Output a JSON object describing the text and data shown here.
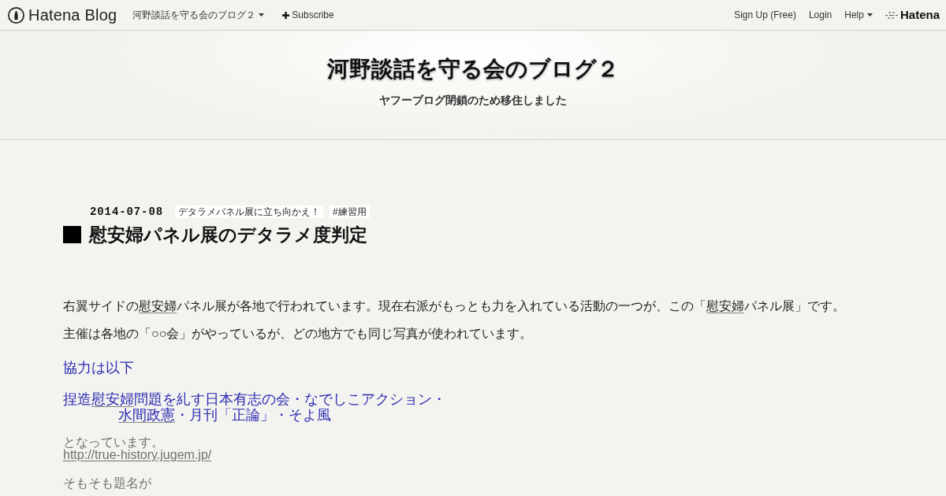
{
  "navbar": {
    "brand": "Hatena Blog",
    "blog_menu": "河野談話を守る会のブログ２",
    "subscribe": "Subscribe",
    "right_links": [
      {
        "kind": "link",
        "label": "Sign Up (Free)"
      },
      {
        "kind": "link",
        "label": "Login"
      },
      {
        "kind": "dropdown",
        "label": "Help"
      }
    ],
    "hatena": "Hatena"
  },
  "header": {
    "title": "河野談話を守る会のブログ２",
    "description": "ヤフーブログ閉鎖のため移住しました"
  },
  "entry": {
    "date": "2014-07-08",
    "categories": [
      "デタラメパネル展に立ち向かえ！",
      "#練習用"
    ],
    "title": "慰安婦パネル展のデタラメ度判定",
    "body": [
      {
        "kind": "paragraph",
        "lines": [
          [
            {
              "kind": "text",
              "text": "右翼サイドの"
            },
            {
              "kind": "keyword",
              "text": "慰安婦"
            },
            {
              "kind": "text",
              "text": "パネル展が各地で行われています。現在右派がもっとも力を入れている活動の一つが、この「"
            },
            {
              "kind": "keyword",
              "text": "慰安婦"
            },
            {
              "kind": "text",
              "text": "パネル展」です。"
            }
          ]
        ]
      },
      {
        "kind": "paragraph",
        "lines": [
          [
            {
              "kind": "text",
              "text": "主催は各地の「○○会」がやっているが、どの地方でも同じ写真が使われています。"
            }
          ]
        ]
      },
      {
        "kind": "highlight",
        "lines": [
          [
            {
              "kind": "text",
              "text": "協力は以下"
            }
          ]
        ]
      },
      {
        "kind": "highlight",
        "lines": [
          [
            {
              "kind": "text",
              "text": "捏造"
            },
            {
              "kind": "keyword",
              "text": "慰安婦"
            },
            {
              "kind": "text",
              "text": "問題を糺す日本有志の会・なでしこアクション・"
            }
          ],
          [
            {
              "kind": "keyword",
              "text": "水間政憲"
            },
            {
              "kind": "text",
              "text": "・月刊「正論」・そよ風"
            }
          ]
        ]
      },
      {
        "kind": "muted",
        "lines": [
          [
            {
              "kind": "text",
              "text": "となっています。"
            }
          ],
          [
            {
              "kind": "link",
              "text": "http://true-history.jugem.jp/"
            }
          ]
        ]
      },
      {
        "kind": "muted",
        "lines": [
          [
            {
              "kind": "text",
              "text": "そもそも題名が"
            }
          ]
        ]
      }
    ]
  }
}
